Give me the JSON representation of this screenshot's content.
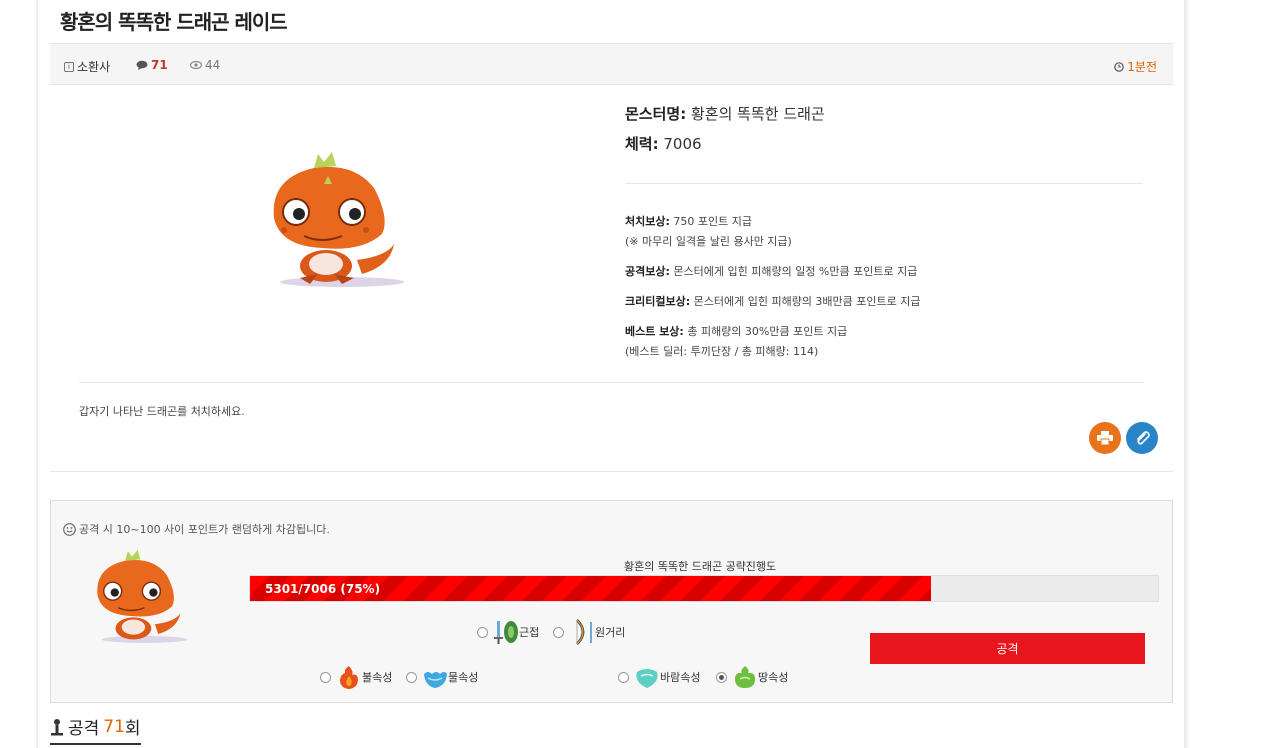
{
  "post": {
    "title": "황혼의 똑똑한 드래곤 레이드",
    "author": "소환사",
    "comments": "71",
    "views": "44",
    "time": "1분전"
  },
  "monster": {
    "name_label": "몬스터명:",
    "name": "황혼의 똑똑한 드래곤",
    "hp_label": "체력:",
    "hp": "7006",
    "image_icon": "orange-dragon-icon"
  },
  "rewards": {
    "kill_label": "처치보상:",
    "kill_text": "750 포인트 지급",
    "kill_note": "(※ 마무리 일격을 날린 용사만 지급)",
    "attack_label": "공격보상:",
    "attack_text": "몬스터에게 입힌 피해량의 일정 %만큼 포인트로 지급",
    "critical_label": "크리티컬보상:",
    "critical_text": "몬스터에게 입힌 피해량의 3배만큼 포인트로 지급",
    "best_label": "베스트 보상:",
    "best_text": "총 피해량의 30%만큼 포인트 지급",
    "best_note": "(베스트 딜러: 투끼단장 / 총 피해량: 114)"
  },
  "description": "갑자기 나타난 드래곤를 처치하세요.",
  "raid": {
    "note": "공격 시 10~100 사이 포인트가 랜덤하게 차감됩니다.",
    "progress_title": "황혼의 똑똑한 드래곤 공략진행도",
    "progress_text": "5301/7006 (75%)",
    "progress_fraction": 0.75,
    "weapons": [
      {
        "label": "근접",
        "checked": false
      },
      {
        "label": "원거리",
        "checked": false
      }
    ],
    "elements": [
      {
        "label": "불속성",
        "checked": false
      },
      {
        "label": "물속성",
        "checked": false
      },
      {
        "label": "바람속성",
        "checked": false
      },
      {
        "label": "땅속성",
        "checked": true
      }
    ],
    "attack_button": "공격"
  },
  "attack_count": {
    "prefix": "공격",
    "count": "71",
    "suffix": "회"
  },
  "colors": {
    "progress": "#ff0000",
    "attack_button": "#e8161c",
    "print_button": "#e8731a",
    "clip_button": "#2a85c8",
    "accent": "#e06400"
  }
}
